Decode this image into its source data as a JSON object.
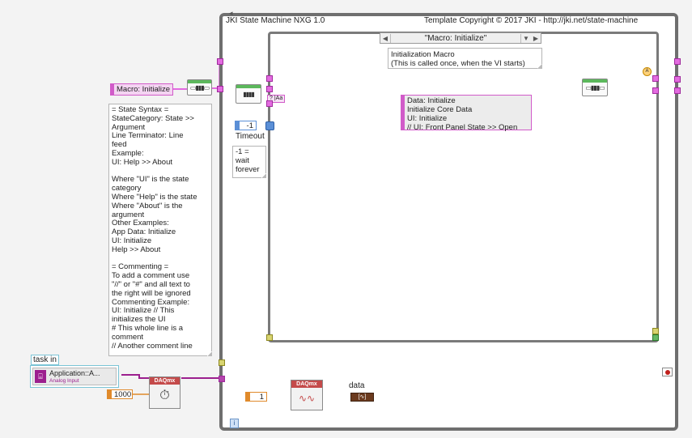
{
  "state_machine": {
    "title": "JKI State Machine NXG 1.0",
    "copyright": "Template Copyright © 2017 JKI - http://jki.net/state-machine"
  },
  "case_selector": {
    "value": "\"Macro: Initialize\"",
    "prev_arrow": "◀",
    "next_arrow": "▶",
    "dropdown_arrow": "▼"
  },
  "case_comment": "Initialization Macro\n(This is called once, when the VI starts)",
  "macro_constant": "Macro: Initialize",
  "syntax_comment": "= State Syntax =\nStateCategory: State >>\nArgument\nLine Terminator: Line\nfeed\nExample:\nUI: Help >> About\n\nWhere \"UI\" is the state\ncategory\nWhere \"Help\" is the state\nWhere \"About\" is the\nargument\nOther Examples:\nApp Data: Initialize\nUI: Initialize\nHelp >> About\n\n= Commenting =\nTo add a comment use\n\"//\" or \"#\" and all text to\nthe right will be ignored\nCommenting Example:\nUI: Initialize // This\ninitializes the UI\n# This whole line is a\ncomment\n// Another comment line",
  "timeout": {
    "value": "-1",
    "label": "Timeout",
    "comment": "-1 =\nwait\nforever"
  },
  "states_constant": "Data: Initialize\nInitialize Core Data\nUI: Initialize\n// UI: Front Panel State >> Open",
  "event_selector_label": "? |Aa",
  "task_in": {
    "label": "task in",
    "channel_name": "Application::A...",
    "channel_type": "Analog Input"
  },
  "daqmx_start": {
    "header": "DAQmx",
    "samples_constant": "1000"
  },
  "daqmx_read": {
    "header": "DAQmx",
    "samples_constant": "1",
    "output_label": "data"
  },
  "info_icon": "i",
  "colors": {
    "string_wire": "#e36be0",
    "cluster_wire": "#b8b035",
    "task_wire": "#9c1f8e",
    "numeric_wire": "#e08a2b",
    "error_wire": "#5a3a20",
    "boolean_wire": "#2a8a2a",
    "stop_button": "#c0201c"
  }
}
